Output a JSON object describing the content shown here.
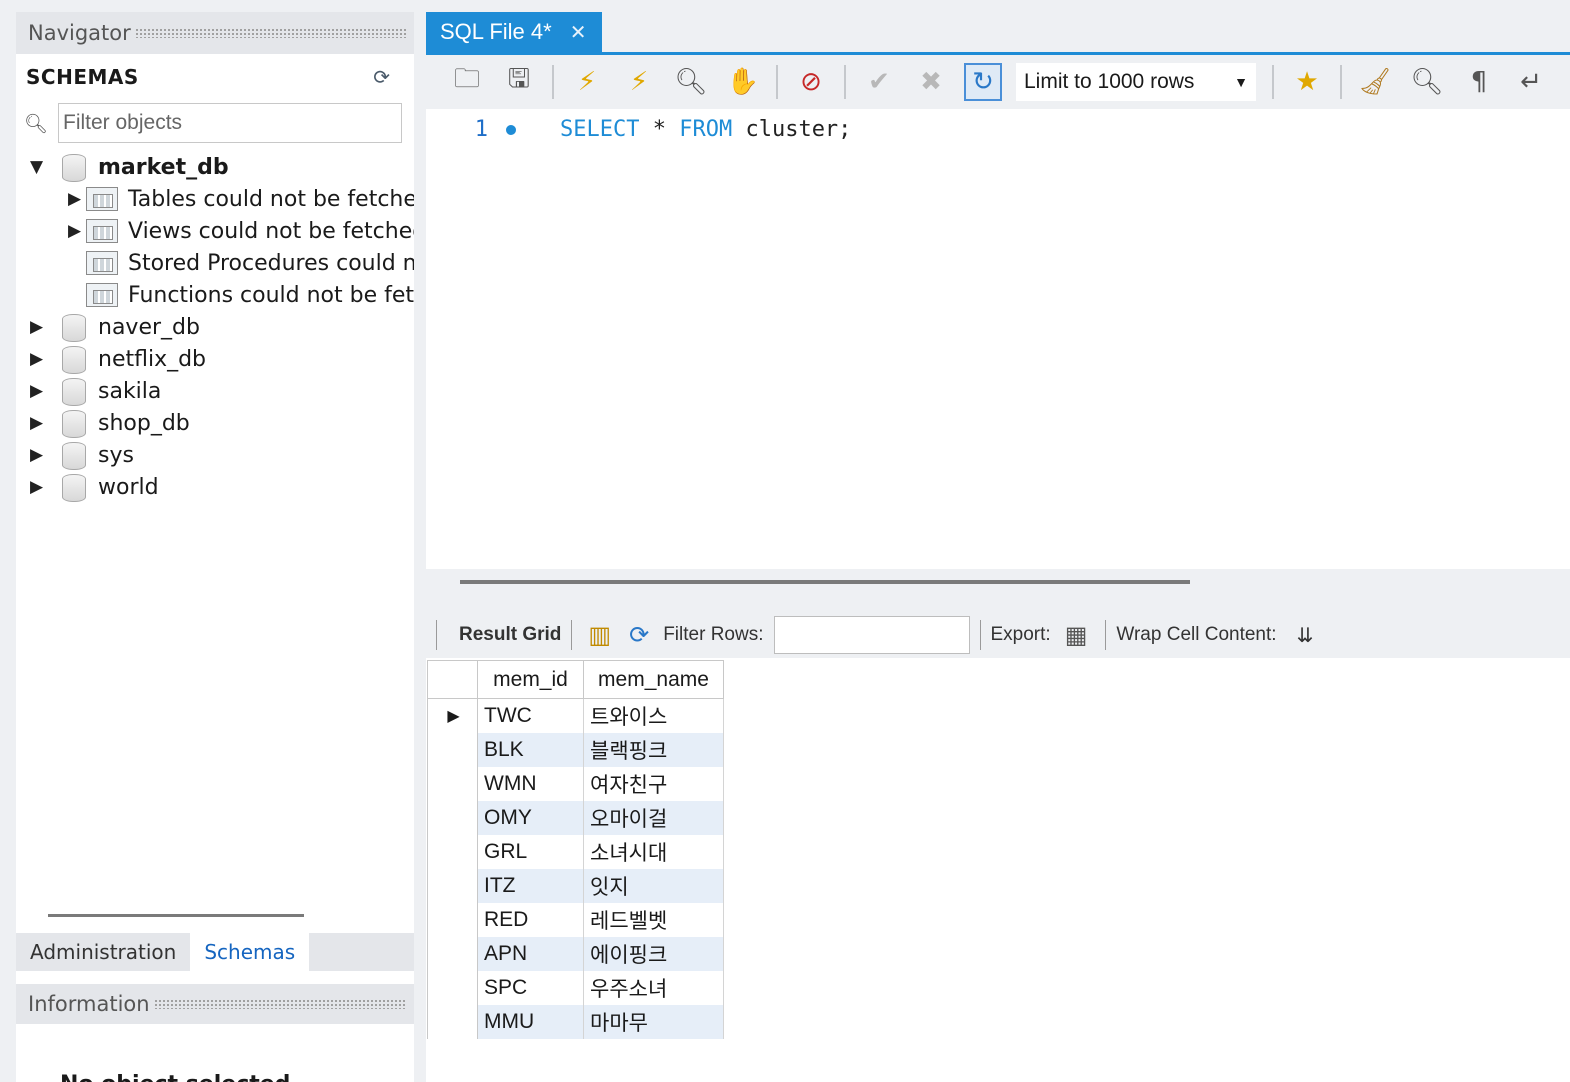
{
  "navigator": {
    "header": "Navigator",
    "schemas_title": "SCHEMAS",
    "filter_placeholder": "Filter objects",
    "tree": [
      {
        "label": "market_db",
        "expanded": true,
        "bold": true
      },
      {
        "label": "Tables could not be fetched"
      },
      {
        "label": "Views could not be fetched"
      },
      {
        "label": "Stored Procedures could not be fetched"
      },
      {
        "label": "Functions could not be fetched"
      },
      {
        "label": "naver_db"
      },
      {
        "label": "netflix_db"
      },
      {
        "label": "sakila"
      },
      {
        "label": "shop_db"
      },
      {
        "label": "sys"
      },
      {
        "label": "world"
      }
    ],
    "bottom_tabs": [
      "Administration",
      "Schemas"
    ],
    "active_bottom_tab": "Schemas",
    "info_header": "Information",
    "info_text": "No object selected"
  },
  "editor": {
    "tab_title": "SQL File 4*",
    "limit_select": "Limit to 1000 rows",
    "line_number": "1",
    "sql": {
      "kw1": "SELECT",
      "star": " * ",
      "kw2": "FROM",
      "rest": " cluster;"
    }
  },
  "result": {
    "grid_label": "Result Grid",
    "filter_label": "Filter Rows:",
    "export_label": "Export:",
    "wrap_label": "Wrap Cell Content:",
    "columns": [
      "mem_id",
      "mem_name"
    ],
    "rows": [
      [
        "TWC",
        "트와이스"
      ],
      [
        "BLK",
        "블랙핑크"
      ],
      [
        "WMN",
        "여자친구"
      ],
      [
        "OMY",
        "오마이걸"
      ],
      [
        "GRL",
        "소녀시대"
      ],
      [
        "ITZ",
        "잇지"
      ],
      [
        "RED",
        "레드벨벳"
      ],
      [
        "APN",
        "에이핑크"
      ],
      [
        "SPC",
        "우주소녀"
      ],
      [
        "MMU",
        "마마무"
      ]
    ]
  },
  "colors": {
    "accent": "#1e8cd6",
    "alt_row": "#e6eef8"
  }
}
